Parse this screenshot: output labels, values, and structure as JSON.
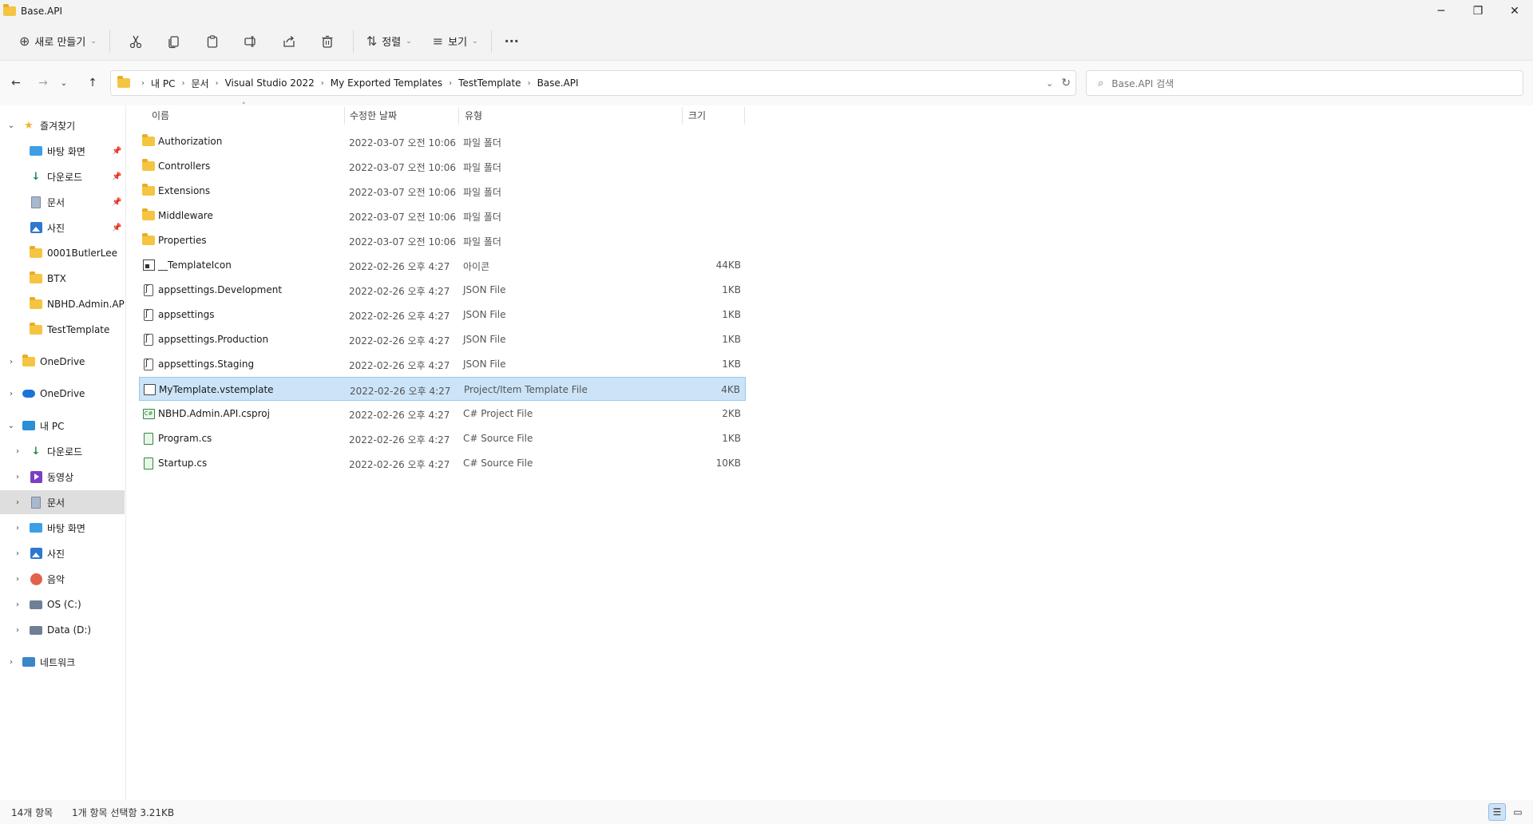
{
  "window": {
    "title": "Base.API",
    "minimize": "─",
    "maximize": "❐",
    "close": "✕"
  },
  "commandbar": {
    "new_label": "새로 만들기",
    "sort_label": "정렬",
    "view_label": "보기",
    "more_label": "···"
  },
  "address": {
    "breadcrumbs": [
      "내 PC",
      "문서",
      "Visual Studio 2022",
      "My Exported Templates",
      "TestTemplate",
      "Base.API"
    ],
    "search_placeholder": "Base.API 검색"
  },
  "sidebar": {
    "items": [
      {
        "label": "즐겨찾기"
      },
      {
        "label": "바탕 화면"
      },
      {
        "label": "다운로드"
      },
      {
        "label": "문서"
      },
      {
        "label": "사진"
      },
      {
        "label": "0001ButlerLee"
      },
      {
        "label": "BTX"
      },
      {
        "label": "NBHD.Admin.API"
      },
      {
        "label": "TestTemplate"
      },
      {
        "label": "OneDrive"
      },
      {
        "label": "OneDrive"
      },
      {
        "label": "내 PC"
      },
      {
        "label": "다운로드"
      },
      {
        "label": "동영상"
      },
      {
        "label": "문서"
      },
      {
        "label": "바탕 화면"
      },
      {
        "label": "사진"
      },
      {
        "label": "음악"
      },
      {
        "label": "OS (C:)"
      },
      {
        "label": "Data (D:)"
      },
      {
        "label": "네트워크"
      }
    ]
  },
  "columns": {
    "name": "이름",
    "date": "수정한 날짜",
    "type": "유형",
    "size": "크기"
  },
  "files": [
    {
      "name": "Authorization",
      "date": "2022-03-07 오전 10:06",
      "type": "파일 폴더",
      "size": ""
    },
    {
      "name": "Controllers",
      "date": "2022-03-07 오전 10:06",
      "type": "파일 폴더",
      "size": ""
    },
    {
      "name": "Extensions",
      "date": "2022-03-07 오전 10:06",
      "type": "파일 폴더",
      "size": ""
    },
    {
      "name": "Middleware",
      "date": "2022-03-07 오전 10:06",
      "type": "파일 폴더",
      "size": ""
    },
    {
      "name": "Properties",
      "date": "2022-03-07 오전 10:06",
      "type": "파일 폴더",
      "size": ""
    },
    {
      "name": "__TemplateIcon",
      "date": "2022-02-26 오후 4:27",
      "type": "아이콘",
      "size": "44KB"
    },
    {
      "name": "appsettings.Development",
      "date": "2022-02-26 오후 4:27",
      "type": "JSON File",
      "size": "1KB"
    },
    {
      "name": "appsettings",
      "date": "2022-02-26 오후 4:27",
      "type": "JSON File",
      "size": "1KB"
    },
    {
      "name": "appsettings.Production",
      "date": "2022-02-26 오후 4:27",
      "type": "JSON File",
      "size": "1KB"
    },
    {
      "name": "appsettings.Staging",
      "date": "2022-02-26 오후 4:27",
      "type": "JSON File",
      "size": "1KB"
    },
    {
      "name": "MyTemplate.vstemplate",
      "date": "2022-02-26 오후 4:27",
      "type": "Project/Item Template File",
      "size": "4KB"
    },
    {
      "name": "NBHD.Admin.API.csproj",
      "date": "2022-02-26 오후 4:27",
      "type": "C# Project File",
      "size": "2KB"
    },
    {
      "name": "Program.cs",
      "date": "2022-02-26 오후 4:27",
      "type": "C# Source File",
      "size": "1KB"
    },
    {
      "name": "Startup.cs",
      "date": "2022-02-26 오후 4:27",
      "type": "C# Source File",
      "size": "10KB"
    }
  ],
  "status": {
    "item_count": "14개 항목",
    "selection": "1개 항목 선택함 3.21KB"
  },
  "colors": {
    "selection": "#cce4f7",
    "folder": "#f5c542",
    "sidebar_selected": "#dedede"
  }
}
